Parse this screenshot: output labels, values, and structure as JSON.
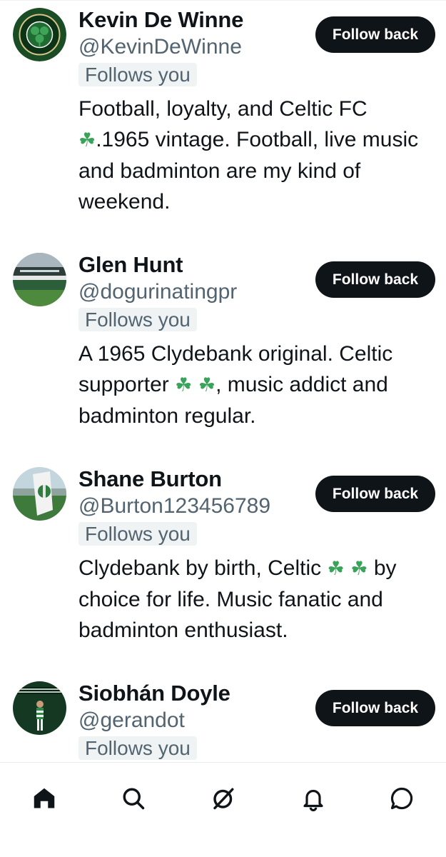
{
  "users": [
    {
      "name": "Kevin De Winne",
      "handle": "@KevinDeWinne",
      "follows_badge": "Follows you",
      "follow_button": "Follow back",
      "bio": [
        "Football, loyalty, and Celtic FC ",
        "☘",
        ".1965 vintage. Football, live music and badminton are my kind of weekend."
      ]
    },
    {
      "name": "Glen Hunt",
      "handle": "@dogurinatingpr",
      "follows_badge": "Follows you",
      "follow_button": "Follow back",
      "bio": [
        "A 1965 Clydebank original. Celtic supporter ",
        "☘ ☘",
        ", music addict and badminton regular."
      ]
    },
    {
      "name": "Shane Burton",
      "handle": "@Burton123456789",
      "follows_badge": "Follows you",
      "follow_button": "Follow back",
      "bio": [
        "Clydebank by birth, Celtic ",
        "☘  ☘",
        " by choice for life. Music fanatic and badminton enthusiast."
      ]
    },
    {
      "name": "Siobhán Doyle",
      "handle": "@gerandot",
      "follows_badge": "Follows you",
      "follow_button": "Follow back",
      "bio": [
        "",
        "",
        ""
      ]
    }
  ],
  "nav": {
    "items": [
      "home-icon",
      "search-icon",
      "grok-icon",
      "notifications-icon",
      "messages-icon"
    ],
    "active": "home-icon"
  },
  "colors": {
    "text": "#0f1419",
    "secondary": "#536471",
    "button_bg": "#0f1419",
    "badge_bg": "#eff3f4",
    "clover": "#3aa35a"
  }
}
